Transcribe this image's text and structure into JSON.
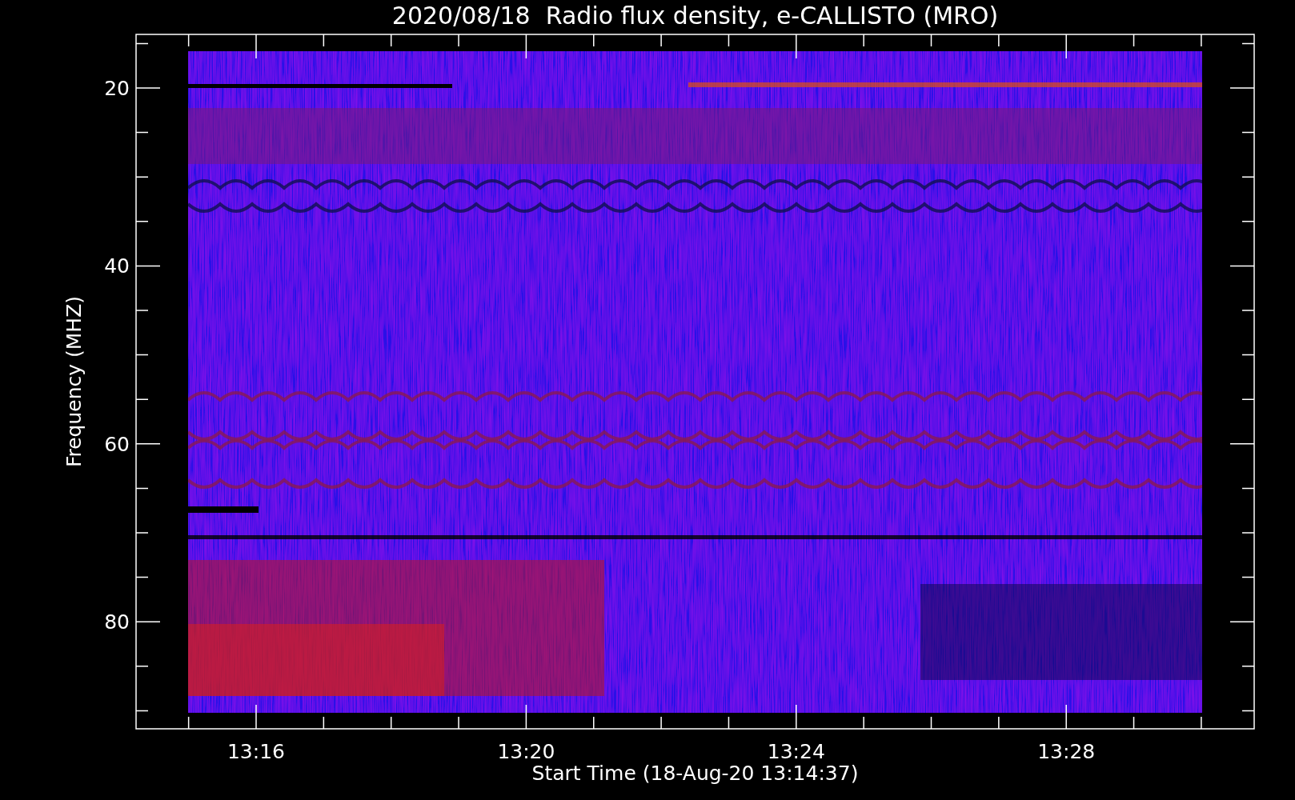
{
  "title": "2020/08/18  Radio flux density, e-CALLISTO (MRO)",
  "y_axis": {
    "label": "Frequency (MHZ)",
    "ticks": [
      "20",
      "40",
      "60",
      "80"
    ]
  },
  "x_axis": {
    "label": "Start Time (18-Aug-20 13:14:37)",
    "ticks": [
      "13:16",
      "13:20",
      "13:24",
      "13:28"
    ]
  }
}
